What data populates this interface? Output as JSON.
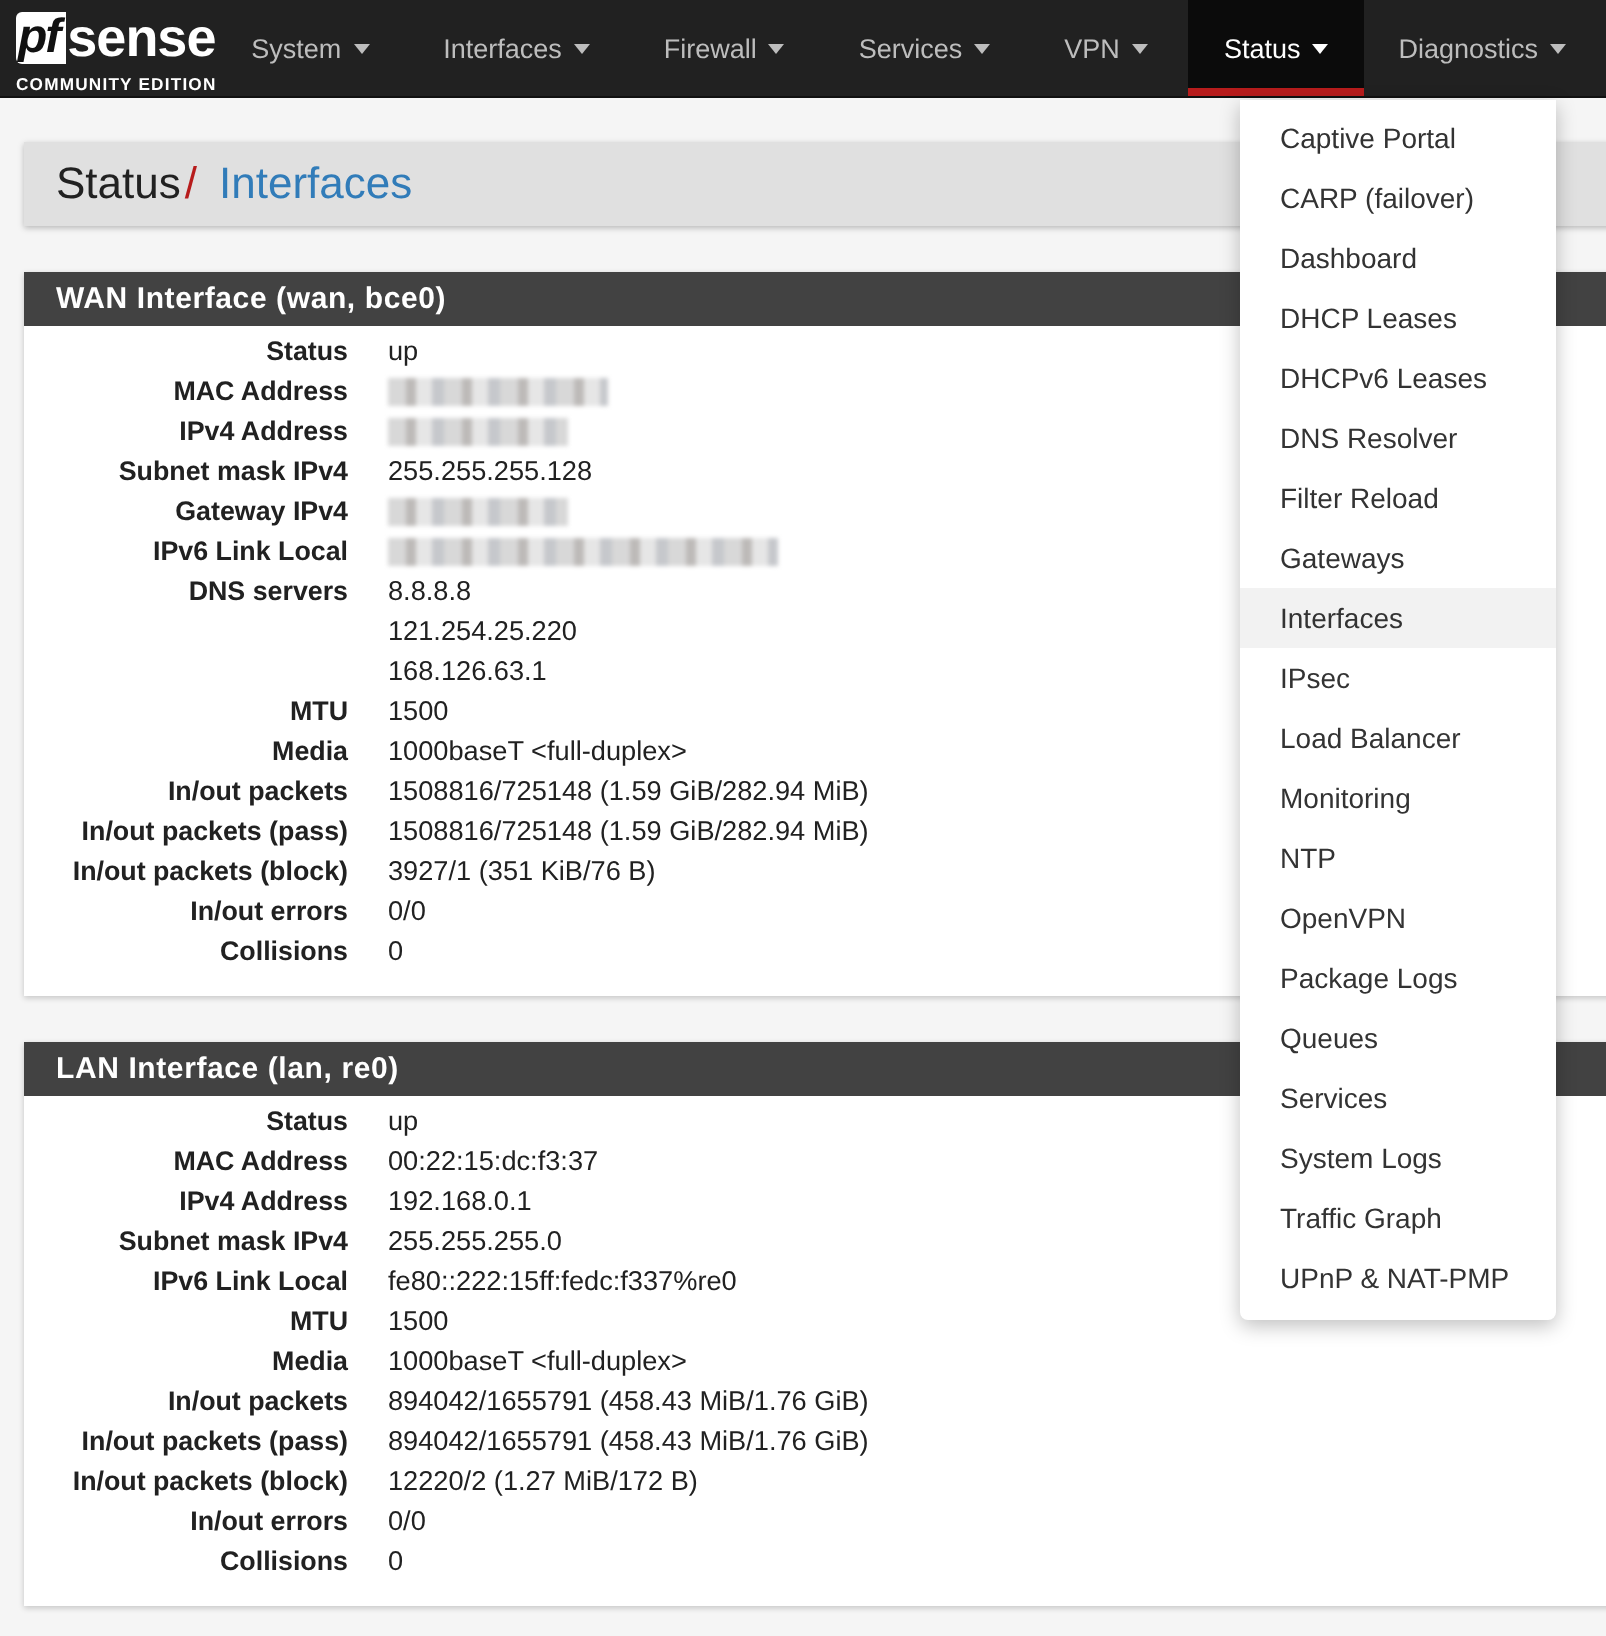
{
  "logo": {
    "mark": "pf",
    "name": "sense",
    "edition": "COMMUNITY EDITION"
  },
  "nav": [
    {
      "label": "System",
      "selected": false
    },
    {
      "label": "Interfaces",
      "selected": false
    },
    {
      "label": "Firewall",
      "selected": false
    },
    {
      "label": "Services",
      "selected": false
    },
    {
      "label": "VPN",
      "selected": false
    },
    {
      "label": "Status",
      "selected": true
    },
    {
      "label": "Diagnostics",
      "selected": false
    }
  ],
  "breadcrumb": {
    "section": "Status",
    "separator": "/",
    "page": "Interfaces"
  },
  "panels": [
    {
      "title": "WAN Interface (wan, bce0)",
      "rows": [
        {
          "label": "Status",
          "values": [
            "up"
          ]
        },
        {
          "label": "MAC Address",
          "redacted": true
        },
        {
          "label": "IPv4 Address",
          "redacted": true
        },
        {
          "label": "Subnet mask IPv4",
          "values": [
            "255.255.255.128"
          ]
        },
        {
          "label": "Gateway IPv4",
          "redacted": true
        },
        {
          "label": "IPv6 Link Local",
          "redacted": true
        },
        {
          "label": "DNS servers",
          "values": [
            "8.8.8.8",
            "121.254.25.220",
            "168.126.63.1"
          ]
        },
        {
          "label": "MTU",
          "values": [
            "1500"
          ]
        },
        {
          "label": "Media",
          "values": [
            "1000baseT <full-duplex>"
          ]
        },
        {
          "label": "In/out packets",
          "values": [
            "1508816/725148 (1.59 GiB/282.94 MiB)"
          ]
        },
        {
          "label": "In/out packets (pass)",
          "values": [
            "1508816/725148 (1.59 GiB/282.94 MiB)"
          ]
        },
        {
          "label": "In/out packets (block)",
          "values": [
            "3927/1 (351 KiB/76 B)"
          ]
        },
        {
          "label": "In/out errors",
          "values": [
            "0/0"
          ]
        },
        {
          "label": "Collisions",
          "values": [
            "0"
          ]
        }
      ]
    },
    {
      "title": "LAN Interface (lan, re0)",
      "rows": [
        {
          "label": "Status",
          "values": [
            "up"
          ]
        },
        {
          "label": "MAC Address",
          "values": [
            "00:22:15:dc:f3:37"
          ]
        },
        {
          "label": "IPv4 Address",
          "values": [
            "192.168.0.1"
          ]
        },
        {
          "label": "Subnet mask IPv4",
          "values": [
            "255.255.255.0"
          ]
        },
        {
          "label": "IPv6 Link Local",
          "values": [
            "fe80::222:15ff:fedc:f337%re0"
          ]
        },
        {
          "label": "MTU",
          "values": [
            "1500"
          ]
        },
        {
          "label": "Media",
          "values": [
            "1000baseT <full-duplex>"
          ]
        },
        {
          "label": "In/out packets",
          "values": [
            "894042/1655791 (458.43 MiB/1.76 GiB)"
          ]
        },
        {
          "label": "In/out packets (pass)",
          "values": [
            "894042/1655791 (458.43 MiB/1.76 GiB)"
          ]
        },
        {
          "label": "In/out packets (block)",
          "values": [
            "12220/2 (1.27 MiB/172 B)"
          ]
        },
        {
          "label": "In/out errors",
          "values": [
            "0/0"
          ]
        },
        {
          "label": "Collisions",
          "values": [
            "0"
          ]
        }
      ]
    }
  ],
  "status_menu": [
    {
      "label": "Captive Portal",
      "hovered": false
    },
    {
      "label": "CARP (failover)",
      "hovered": false
    },
    {
      "label": "Dashboard",
      "hovered": false
    },
    {
      "label": "DHCP Leases",
      "hovered": false
    },
    {
      "label": "DHCPv6 Leases",
      "hovered": false
    },
    {
      "label": "DNS Resolver",
      "hovered": false
    },
    {
      "label": "Filter Reload",
      "hovered": false
    },
    {
      "label": "Gateways",
      "hovered": false
    },
    {
      "label": "Interfaces",
      "hovered": true
    },
    {
      "label": "IPsec",
      "hovered": false
    },
    {
      "label": "Load Balancer",
      "hovered": false
    },
    {
      "label": "Monitoring",
      "hovered": false
    },
    {
      "label": "NTP",
      "hovered": false
    },
    {
      "label": "OpenVPN",
      "hovered": false
    },
    {
      "label": "Package Logs",
      "hovered": false
    },
    {
      "label": "Queues",
      "hovered": false
    },
    {
      "label": "Services",
      "hovered": false
    },
    {
      "label": "System Logs",
      "hovered": false
    },
    {
      "label": "Traffic Graph",
      "hovered": false
    },
    {
      "label": "UPnP & NAT-PMP",
      "hovered": false
    }
  ]
}
